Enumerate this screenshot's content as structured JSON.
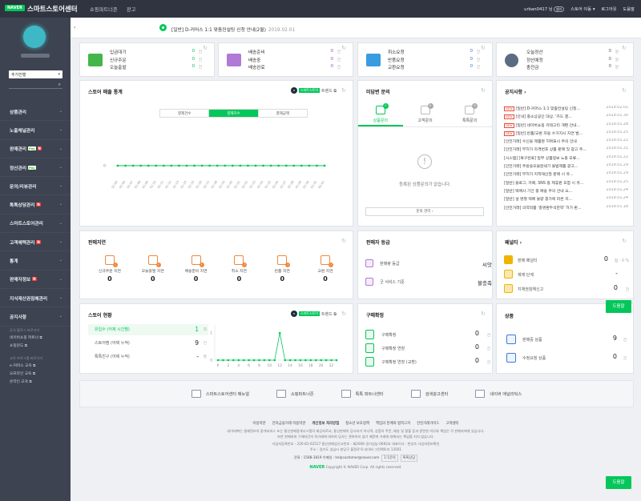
{
  "header": {
    "logo": "NAVER",
    "brand": "스마트스토어센터",
    "nav": [
      "쇼핑파트너존",
      "광고"
    ],
    "user": "urban0417 님",
    "user_badge": "셀러",
    "links": [
      "스토어 이동 ▾",
      "로그아웃",
      "도움말"
    ]
  },
  "sidebar": {
    "store_select": "추가진행",
    "menu": [
      {
        "label": "상품관리"
      },
      {
        "label": "노출채널관리"
      },
      {
        "label": "판매관리",
        "npay": "Pay",
        "badge": "N"
      },
      {
        "label": "정산관리",
        "npay": "Pay"
      },
      {
        "label": "문의/리뷰관리"
      },
      {
        "label": "톡톡상담관리",
        "badge": "N"
      },
      {
        "label": "스마트스토어관리"
      },
      {
        "label": "고객혜택관리",
        "badge": "N"
      },
      {
        "label": "통계"
      },
      {
        "label": "판매자정보",
        "badge": "N"
      },
      {
        "label": "지식재산권침해관리"
      },
      {
        "label": "공지사항"
      }
    ],
    "shortcut_title_1": "공식 블로그 바로가기",
    "shortcuts_1": [
      "네이버쇼핑 파트너 ⧉",
      "쇼핑윈도 ⧉"
    ],
    "shortcut_title_2": "교육 프로그램 바로가기",
    "shortcuts_2": [
      "e-커머스 교육 ⧉",
      "오프라인 교육 ⧉",
      "온라인 교육 ⧉"
    ]
  },
  "notice_bar": {
    "text": "[일반] D-커머스 1:1 맞춤컨설팅 신청 안내(2월)",
    "date": "2019.02.01"
  },
  "stats": {
    "order": {
      "rows": [
        {
          "label": "입금대기",
          "value": "0",
          "unit": "건"
        },
        {
          "label": "신규주문",
          "value": "0",
          "unit": "건"
        },
        {
          "label": "오늘출발",
          "value": "0",
          "unit": "건"
        }
      ]
    },
    "delivery": {
      "rows": [
        {
          "label": "배송준비",
          "value": "0",
          "unit": "건"
        },
        {
          "label": "배송중",
          "value": "0",
          "unit": "건"
        },
        {
          "label": "배송완료",
          "value": "0",
          "unit": "건"
        }
      ]
    },
    "claim": {
      "rows": [
        {
          "label": "취소요청",
          "value": "0",
          "unit": "건"
        },
        {
          "label": "반품요청",
          "value": "0",
          "unit": "건"
        },
        {
          "label": "교환요청",
          "value": "0",
          "unit": "건"
        }
      ]
    },
    "settle": {
      "rows": [
        {
          "label": "오늘정산",
          "value": "0",
          "unit": "원"
        },
        {
          "label": "정산예정",
          "value": "0",
          "unit": "원"
        },
        {
          "label": "충전금",
          "value": "0",
          "unit": "원"
        }
      ]
    }
  },
  "sales_card": {
    "title": "스토어 매출 통계",
    "trend_tag": "스마트스토어",
    "trend_label": "트렌드 ⧉",
    "tabs": [
      "결제건수",
      "결제자수",
      "결제금액"
    ],
    "active_tab": 1
  },
  "qa_card": {
    "title": "미답변 문의",
    "tabs": [
      {
        "label": "상품문의",
        "count": "0"
      },
      {
        "label": "고객문의",
        "count": "0"
      },
      {
        "label": "톡톡문의",
        "count": "0"
      }
    ],
    "empty_message": "등록된 상품문의가 없습니다.",
    "button": "문의 관리 ›"
  },
  "notice_card": {
    "title": "공지사항 ›",
    "items": [
      {
        "new": "NEW",
        "text": "[일반] D-커머스 1:1 맞춤컨설팅 신청...",
        "date": "2019.02.01"
      },
      {
        "new": "NEW",
        "text": "[안내] 중소상공인 대상, '카드 결...",
        "date": "2019.01.30"
      },
      {
        "new": "NEW",
        "text": "[일반] 네이버쇼핑 카테고리 개편 안내...",
        "date": "2019.01.28"
      },
      {
        "new": "NEW",
        "text": "[일반] 반품/교환 자동 수거지시 지연 발...",
        "date": "2019.01.25"
      },
      {
        "new": "",
        "text": "[안전거래] 수신을 제품명 허위표시 주의 안내",
        "date": "2019.01.22"
      },
      {
        "new": "",
        "text": "[안전거래] 무허가 자격번호 상품 판매 및 광고 주...",
        "date": "2019.01.31"
      },
      {
        "new": "",
        "text": "[시스템] [복구완료] 일부 상품정보 노출 오류...",
        "date": "2019.01.22"
      },
      {
        "new": "",
        "text": "[안전거래] 주방용오물분쇄기 불법제품 광고...",
        "date": "2019.01.29"
      },
      {
        "new": "",
        "text": "[안전거래] 무허가 지적재산권 판매 시 유...",
        "date": "2019.01.29"
      },
      {
        "new": "",
        "text": "[일반] 블로그, 카페, SNS 등 제휴판 포함 시 유...",
        "date": "2019.01.25"
      },
      {
        "new": "",
        "text": "[일반] 택배사 기간 중 배송 주의 안내 요...",
        "date": "2019.01.24"
      },
      {
        "new": "",
        "text": "[일반] 설 명절 택배 물량 증가에 따른 지...",
        "date": "2019.01.24"
      },
      {
        "new": "",
        "text": "[안전거래] 의약외품 '총명환두석한학' 허가 판...",
        "date": "2019.01.18"
      }
    ]
  },
  "delay_card": {
    "title": "판매지연",
    "items": [
      {
        "label": "신규주문 지연",
        "value": "0",
        "count": "!"
      },
      {
        "label": "오늘출발 지연",
        "value": "0",
        "count": "!"
      },
      {
        "label": "배송준비 지연",
        "value": "0",
        "count": "!"
      },
      {
        "label": "취소 지연",
        "value": "0",
        "count": "!"
      },
      {
        "label": "반품 지연",
        "value": "0",
        "count": "!"
      },
      {
        "label": "교환 지연",
        "value": "0",
        "count": "!"
      }
    ]
  },
  "grade_card": {
    "title": "판매자 등급",
    "rows": [
      {
        "label": "판매량 등급",
        "value": "씨앗"
      },
      {
        "label": "굿 서비스 기준",
        "value": "불충족"
      }
    ]
  },
  "penalty_card": {
    "title": "페널티 ›",
    "rows": [
      {
        "label": "판매 페널티",
        "value": "0",
        "unit": "점 · 0 %"
      },
      {
        "label": "제재 단계",
        "value": "-",
        "unit": ""
      },
      {
        "label": "지재권침해신고",
        "value": "0",
        "unit": "건"
      }
    ]
  },
  "visit_card": {
    "title": "스토어 현황",
    "trend_tag": "스마트스토어",
    "trend_label": "트렌드 ⧉",
    "rows": [
      {
        "label": "유입수 (어제 시간별)",
        "value": "1",
        "unit": "회"
      },
      {
        "label": "스토어찜 (어제 누적)",
        "value": "9",
        "unit": "건"
      },
      {
        "label": "톡톡친구 (어제 누적)",
        "value": "-",
        "unit": "명"
      }
    ]
  },
  "purchase_card": {
    "title": "구매확정",
    "rows": [
      {
        "label": "구매확정",
        "value": "0",
        "unit": "건"
      },
      {
        "label": "구매확정 연장",
        "value": "0",
        "unit": "건"
      },
      {
        "label": "구매확정 연장 (교환)",
        "value": "0",
        "unit": "건"
      }
    ]
  },
  "product_card": {
    "title": "상품",
    "rows": [
      {
        "label": "판매중 상품",
        "value": "9",
        "unit": "건"
      },
      {
        "label": "수정요청 상품",
        "value": "0",
        "unit": "건"
      }
    ]
  },
  "quick_links": [
    "스마트스토어센터 매뉴얼",
    "쇼핑파트너존",
    "톡톡 파트너센터",
    "검색광고센터",
    "네이버 애널리틱스"
  ],
  "help_label": "도움말",
  "footer": {
    "links": [
      "이용약관",
      "전자금융거래 이용약관",
      "개인정보 처리방침",
      "청소년 보호정책",
      "책임의 한계와 법적고지",
      "안전거래가이드",
      "고객센터"
    ],
    "bold_link": "개인정보 처리방침",
    "disclaimer_1": "네이버㈜는 결제정보의 중개서비스 또는 통신판매중개시스템의 제공자로서, 통신판매의 당사자가 아니며, 상품의 주문, 배송 및 환불 등과 관련한 의무와 책임은 각 판매자에게 있습니다.",
    "disclaimer_2": "또한 판매자와 구매자간의 직거래에 대하여 당사는 관여하지 않기 때문에 거래에 대해서는 책임을 지지 않습니다.",
    "biz": "사업자등록번호 : 220-81-62517    통신판매업신고번호 : 제2006-경기성남-0692호    대표이사 : 한성숙    사업자정보확인",
    "address": "주소 : 경기도 성남시 분당구 불정로 6 네이버 그린팩토리 13561",
    "contact": "전화 : 1588-3819    이메일 : helpcustomer@naver.com",
    "btn1": "1:1문의",
    "btn2": "톡톡상담",
    "copy_brand": "NAVER",
    "copyright": "Copyright © NAVER Corp. All rights reserved."
  },
  "chart_data": [
    {
      "type": "line",
      "title": "스토어 매출 통계",
      "x": [
        "01-05",
        "01-06",
        "01-07",
        "01-08",
        "01-09",
        "01-10",
        "01-11",
        "01-12",
        "01-13",
        "01-14",
        "01-15",
        "01-16",
        "01-17",
        "01-18",
        "01-19",
        "01-20",
        "01-21",
        "01-22",
        "01-23",
        "01-24",
        "01-25",
        "01-26",
        "01-27",
        "01-28",
        "01-29",
        "01-30",
        "01-31",
        "02-01"
      ],
      "series": [
        {
          "name": "결제자수",
          "values": [
            0,
            0,
            0,
            0,
            0,
            0,
            0,
            0,
            0,
            0,
            0,
            0,
            0,
            0,
            0,
            0,
            0,
            0,
            0,
            0,
            0,
            0,
            0,
            0,
            0,
            0,
            0,
            0
          ]
        }
      ],
      "yticks": [
        "0"
      ],
      "color": "#03c75a"
    },
    {
      "type": "line",
      "title": "유입수 (어제 시간별)",
      "x": [
        "0",
        "1",
        "2",
        "3",
        "4",
        "5",
        "6",
        "7",
        "8",
        "9",
        "10",
        "11",
        "12",
        "13",
        "14",
        "15",
        "16",
        "17",
        "18",
        "19",
        "20",
        "21",
        "22",
        "23"
      ],
      "x_tick_labels": [
        "0",
        "2",
        "4",
        "6",
        "8",
        "10",
        "12",
        "14",
        "16",
        "18",
        "20",
        "22"
      ],
      "series": [
        {
          "name": "유입수",
          "values": [
            0,
            0,
            0,
            0,
            0,
            0,
            0,
            0,
            0,
            0,
            0,
            0,
            1,
            0,
            0,
            0,
            0,
            0,
            0,
            0,
            0,
            0,
            0,
            0
          ]
        }
      ],
      "yticks": [
        "0",
        "1"
      ],
      "color": "#03c75a"
    }
  ],
  "colors": {
    "accent": "#03c75a",
    "sidebar": "#3d4350",
    "topbar": "#2f3440"
  }
}
